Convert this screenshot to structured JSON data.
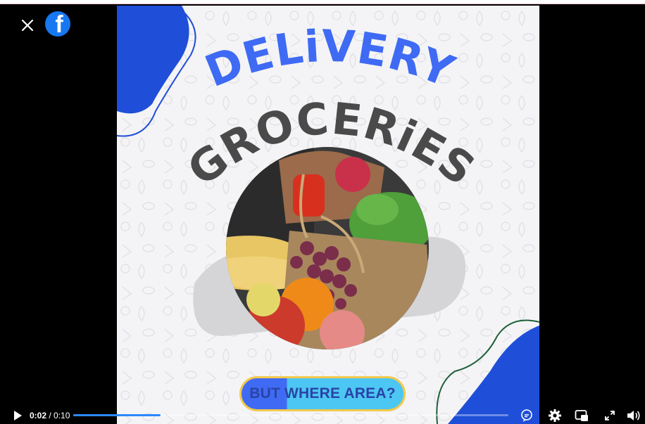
{
  "player": {
    "close_icon": "close-icon",
    "logo_icon": "facebook-logo-icon",
    "logo_glyph": "f"
  },
  "video": {
    "headline_1": "DELiVERY",
    "headline_2": "GROCERiES",
    "pill_text": "BUT WHERE AREA?",
    "colors": {
      "accent_blue": "#3f6af3",
      "dark_text": "#4a4a4a",
      "pill_light": "#4cc6f3",
      "pill_border": "#f2c94c"
    }
  },
  "controls": {
    "current_time": "0:02",
    "separator": " / ",
    "duration": "0:10",
    "progress": 0.2,
    "buffered": 0.17,
    "icons": [
      "play-icon",
      "captions-icon",
      "settings-icon",
      "pip-icon",
      "fullscreen-icon",
      "volume-icon"
    ],
    "progress_color": "#2d88ff"
  }
}
